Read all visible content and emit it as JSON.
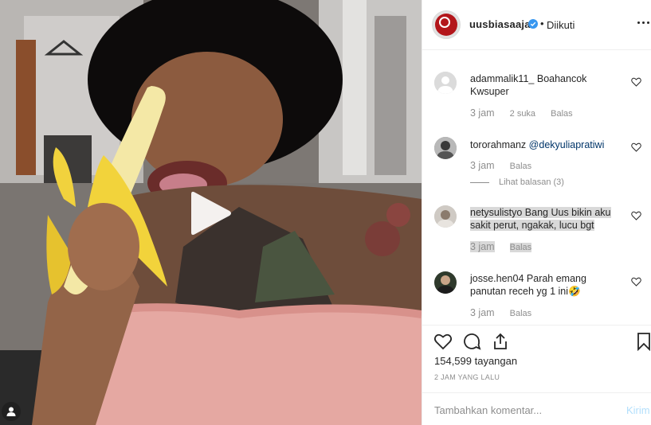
{
  "header": {
    "username": "uusbiasaaja",
    "separator": "•",
    "follow_status": "Diikuti"
  },
  "comments": [
    {
      "user": "adammalik11_",
      "text": "Boahancok Kwsuper",
      "time": "3 jam",
      "likes": "2 suka",
      "reply": "Balas",
      "avatar": "default-avatar"
    },
    {
      "user": "tororahmanz",
      "mention": "@dekyuliapratiwi",
      "text": "",
      "time": "3 jam",
      "reply": "Balas",
      "view_replies": "Lihat balasan (3)",
      "avatar": "photo-avatar"
    },
    {
      "user": "netysulistyo",
      "text": "Bang Uus bikin aku sakit perut, ngakak, lucu bgt",
      "time": "3 jam",
      "reply": "Balas",
      "avatar": "photo-avatar",
      "highlighted": true
    },
    {
      "user": "josse.hen04",
      "text": "Parah emang panutan receh yg 1 ini🤣",
      "time": "3 jam",
      "reply": "Balas",
      "avatar": "photo-avatar"
    }
  ],
  "stats": {
    "views": "154,599 tayangan",
    "posted_ago": "2 JAM YANG LALU"
  },
  "composer": {
    "placeholder": "Tambahkan komentar...",
    "post_label": "Kirim"
  },
  "colors": {
    "link": "#003569",
    "muted": "#8e8e8e",
    "verified": "#3897f0",
    "post_disabled": "#b2dffc"
  },
  "icons": [
    "play-icon",
    "sound-icon",
    "verified-badge-icon",
    "more-options-icon",
    "heart-icon",
    "comment-icon",
    "share-icon",
    "bookmark-icon"
  ]
}
